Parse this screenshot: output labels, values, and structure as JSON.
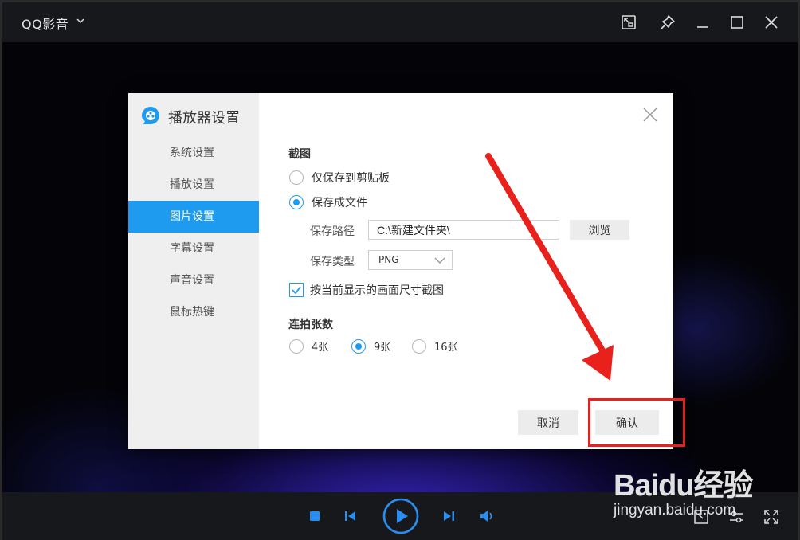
{
  "app": {
    "title": "QQ影音"
  },
  "titlebar_icons": [
    "screenshot-window-icon",
    "pin-icon",
    "minimize-icon",
    "maximize-icon",
    "close-icon"
  ],
  "dialog": {
    "title": "播放器设置",
    "sidebar": [
      {
        "label": "系统设置",
        "active": false
      },
      {
        "label": "播放设置",
        "active": false
      },
      {
        "label": "图片设置",
        "active": true
      },
      {
        "label": "字幕设置",
        "active": false
      },
      {
        "label": "声音设置",
        "active": false
      },
      {
        "label": "鼠标热键",
        "active": false
      }
    ],
    "screenshot_section": {
      "title": "截图",
      "options": [
        {
          "label": "仅保存到剪贴板",
          "checked": false
        },
        {
          "label": "保存成文件",
          "checked": true
        }
      ],
      "path_label": "保存路径",
      "path_value": "C:\\新建文件夹\\",
      "browse_label": "浏览",
      "type_label": "保存类型",
      "type_value": "PNG",
      "size_checkbox": {
        "label": "按当前显示的画面尺寸截图",
        "checked": true
      }
    },
    "burst_section": {
      "title": "连拍张数",
      "options": [
        {
          "label": "4张",
          "checked": false
        },
        {
          "label": "9张",
          "checked": true
        },
        {
          "label": "16张",
          "checked": false
        }
      ]
    },
    "buttons": {
      "cancel": "取消",
      "confirm": "确认"
    }
  },
  "colors": {
    "accent": "#1e9bef",
    "annotation": "#e8211d",
    "titlebar": "#16181c"
  },
  "watermark": {
    "brand": "Baidu经验",
    "url": "jingyan.baidu.com"
  }
}
